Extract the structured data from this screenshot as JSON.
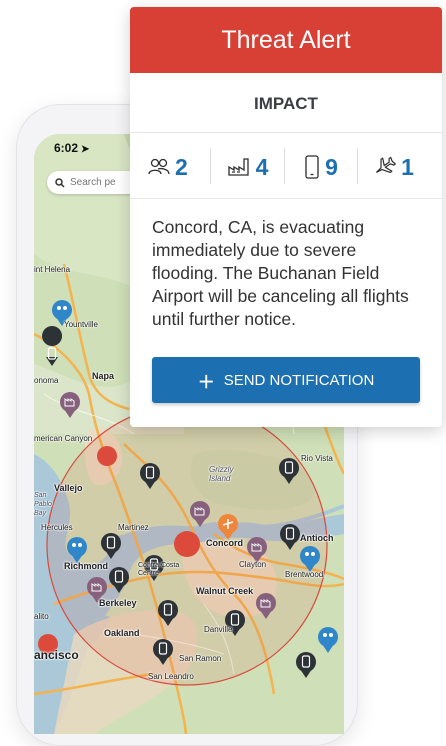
{
  "alert": {
    "title": "Threat Alert",
    "impact_heading": "IMPACT",
    "stats": [
      {
        "icon": "people-icon",
        "value": "2"
      },
      {
        "icon": "factory-icon",
        "value": "4"
      },
      {
        "icon": "phone-icon",
        "value": "9"
      },
      {
        "icon": "airplane-icon",
        "value": "1"
      }
    ],
    "message": "Concord, CA, is evacuating immediately due to severe flooding. The Buchanan Field Airport will be canceling all flights until further notice.",
    "button_label": "SEND NOTIFICATION"
  },
  "phone": {
    "status_time": "6:02",
    "search_placeholder": "Search pe"
  },
  "map": {
    "places": {
      "saint_helena": "int Helena",
      "yountville": "Yountville",
      "napa": "Napa",
      "sonoma": "onoma",
      "american_canyon": "merican Canyon",
      "vallejo": "Vallejo",
      "grizzly_island": "Grizzly Island",
      "rio_vista": "Rio Vista",
      "san_pablo_bay": "San Pablo Bay",
      "hercules": "Hercules",
      "martinez": "Martinez",
      "antioch": "Antioch",
      "concord": "Concord",
      "richmond": "Richmond",
      "contra_costa_centre": "Contra Costa Centre",
      "clayton": "Clayton",
      "brentwood": "Brentwood",
      "berkeley": "Berkeley",
      "walnut_creek": "Walnut Creek",
      "alito": "alito",
      "oakland": "Oakland",
      "danville": "Danville",
      "san_francisco": "ancisco",
      "san_ramon": "San Ramon",
      "san_leandro": "San Leandro"
    }
  },
  "colors": {
    "alert_red": "#d94035",
    "accent_blue": "#1c6fb1",
    "map_land": "#cfe0b8",
    "map_water": "#aac8d8",
    "pin_dark": "#2c3236",
    "pin_purple": "#86607c",
    "pin_blue": "#2f86c8",
    "pin_orange": "#f0863a"
  }
}
